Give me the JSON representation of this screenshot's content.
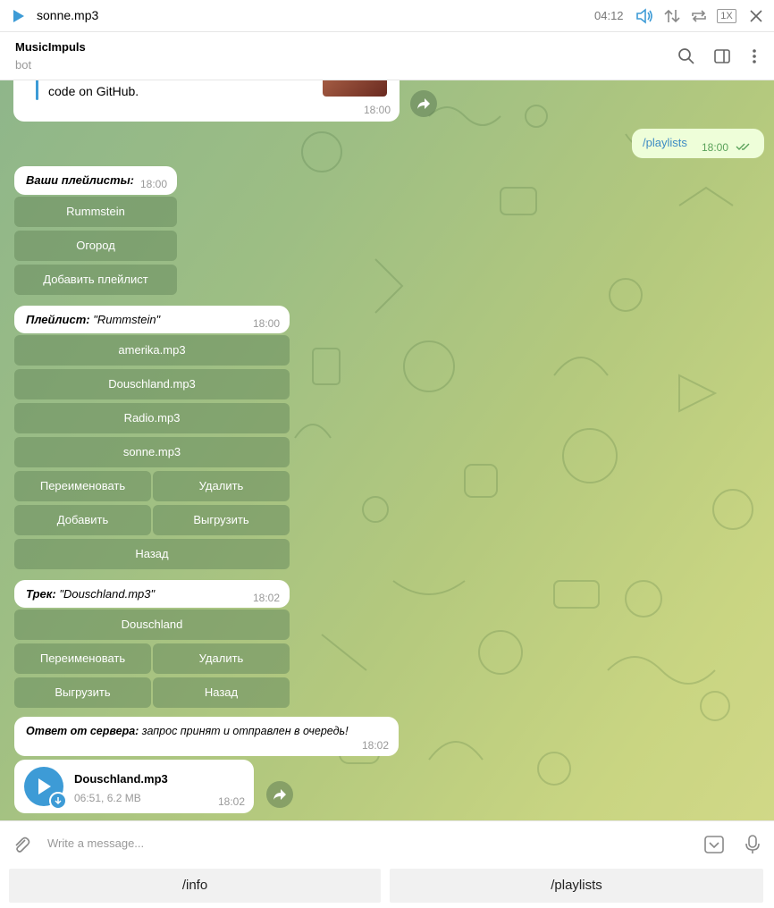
{
  "player": {
    "track": "sonne.mp3",
    "time": "04:12",
    "speed": "1X"
  },
  "header": {
    "name": "MusicImpuls",
    "status": "bot"
  },
  "messages": {
    "github": {
      "text": "code on GitHub.",
      "time": "18:00"
    },
    "outgoing": {
      "text": "/playlists",
      "time": "18:00"
    },
    "playlists": {
      "title": "Ваши плейлисты:",
      "time": "18:00",
      "buttons": [
        "Rummstein",
        "Огород",
        "Добавить плейлист"
      ]
    },
    "playlist": {
      "label": "Плейлист:",
      "value": " \"Rummstein\"",
      "time": "18:00",
      "tracks": [
        "amerika.mp3",
        "Douschland.mp3",
        "Radio.mp3",
        "sonne.mp3"
      ],
      "actions": [
        "Переименовать",
        "Удалить",
        "Добавить",
        "Выгрузить"
      ],
      "back": "Назад"
    },
    "track": {
      "label": "Трек:",
      "value": " \"Douschland.mp3\"",
      "time": "18:02",
      "buttons": [
        "Douschland",
        "Переименовать",
        "Удалить",
        "Выгрузить",
        "Назад"
      ]
    },
    "server": {
      "label": "Ответ от сервера:",
      "value": " запрос принят и отправлен в очередь!",
      "time": "18:02"
    },
    "audio": {
      "name": "Douschland.mp3",
      "meta": "06:51, 6.2 MB",
      "time": "18:02"
    }
  },
  "composer": {
    "placeholder": "Write a message..."
  },
  "reply_keyboard": [
    "/info",
    "/playlists"
  ]
}
